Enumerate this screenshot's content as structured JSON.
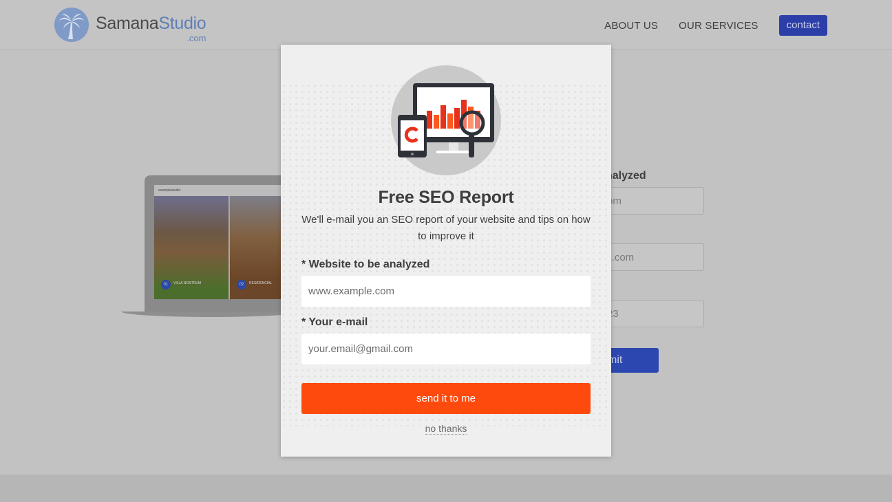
{
  "header": {
    "logo_main_1": "Samana",
    "logo_main_2": "Studio",
    "logo_sub": ".com",
    "nav": {
      "about": "ABOUT US",
      "services": "OUR SERVICES",
      "contact": "contact"
    }
  },
  "background_form": {
    "label_partial": "nalyzed",
    "website_partial": "om",
    "email_partial": "il.com",
    "phone_partial": "23",
    "submit_partial": "mit"
  },
  "laptop_screen": {
    "brand": "examplestudio",
    "item1_num": "01",
    "item1_caption": "VILLA NOSTRUM",
    "item2_num": "02",
    "item2_caption": "RESIDENCIAL"
  },
  "modal": {
    "title": "Free SEO Report",
    "subtitle": "We'll e-mail you an SEO report of your website and tips on how to improve it",
    "website_label": "* Website to be analyzed",
    "website_placeholder": "www.example.com",
    "email_label": "* Your e-mail",
    "email_placeholder": "your.email@gmail.com",
    "send_label": "send it to me",
    "no_thanks": "no thanks",
    "hero_icon": "seo-monitor-icon"
  },
  "colors": {
    "accent_orange": "#ff4a0e",
    "brand_blue": "#2c3ea8",
    "overlay_gray": "#c2c2c2",
    "modal_bg": "#efefef"
  }
}
